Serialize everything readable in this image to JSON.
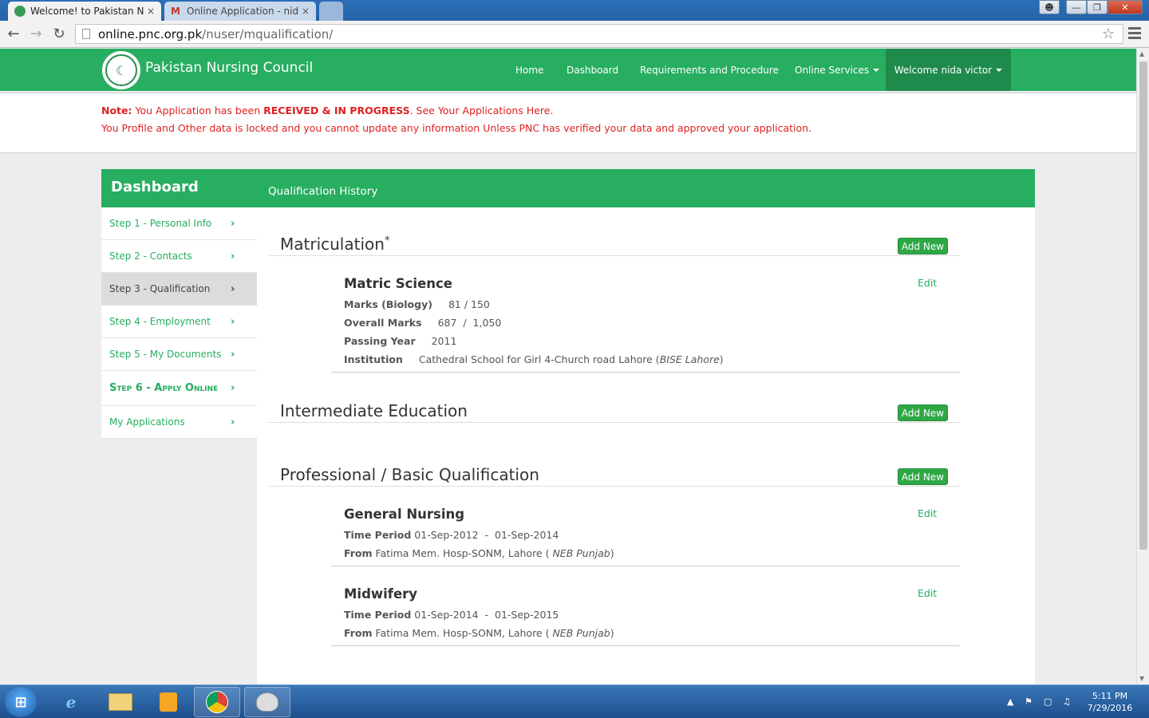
{
  "browser": {
    "tabs": [
      {
        "title": "Welcome! to Pakistan Nursing Council",
        "close": "×",
        "active": true
      },
      {
        "title": "Online Application - nida",
        "close": "×",
        "active": false
      }
    ],
    "url_host": "online.pnc.org.pk",
    "url_path": "/nuser/mqualification/",
    "icons": {
      "back": "arrow-left-icon",
      "forward": "arrow-right-icon",
      "reload": "reload-icon",
      "bookmark": "star-icon",
      "menu": "hamburger-icon"
    }
  },
  "site": {
    "brand": "Pakistan Nursing Council",
    "nav": {
      "home": "Home",
      "dashboard": "Dashboard",
      "requirements": "Requirements and Procedure",
      "online_services": "Online Services",
      "welcome": "Welcome nida victor"
    },
    "colors": {
      "primary": "#27ae60",
      "nav_active": "#1e8b4c",
      "notice": "#e02020",
      "button": "#2ea845"
    }
  },
  "notice": {
    "note_label": "Note:",
    "line1_a": " You Application has been ",
    "line1_status": "RECEIVED & IN PROGRESS",
    "line1_b": ". See Your Applications ",
    "line1_link": "Here",
    "line1_end": ".",
    "line2": "You Profile and Other data is locked and you cannot update any information Unless PNC has verified your data and approved your application."
  },
  "sidebar": {
    "title": "Dashboard",
    "chevron": "›",
    "items": [
      {
        "label": "Step 1 - Personal Info"
      },
      {
        "label": "Step 2 - Contacts"
      },
      {
        "label": "Step 3 - Qualification"
      },
      {
        "label": "Step 4 - Employment"
      },
      {
        "label": "Step 5 - My Documents"
      },
      {
        "label": "Step 6 - Apply Online"
      },
      {
        "label": "My Applications"
      }
    ]
  },
  "panel": {
    "title": "Qualification History",
    "add_label": "Add New",
    "edit_label": "Edit",
    "matric": {
      "title": "Matriculation",
      "required_mark": "*",
      "entry": {
        "title": "Matric Science",
        "marks_bio_label": "Marks (Biology)",
        "marks_bio_value": "81 / 150",
        "overall_label": "Overall Marks",
        "overall_value": "687  /  1,050",
        "year_label": "Passing Year",
        "year_value": "2011",
        "inst_label": "Institution",
        "inst_value": "Cathedral School for Girl 4-Church road Lahore (",
        "inst_board": "BISE Lahore",
        "inst_end": ")"
      }
    },
    "intermediate": {
      "title": "Intermediate Education"
    },
    "professional": {
      "title": "Professional / Basic Qualification",
      "entries": [
        {
          "title": "General Nursing",
          "period_label": "Time Period",
          "period_value": "01-Sep-2012  -  01-Sep-2014",
          "from_label": "From",
          "from_value": "Fatima Mem. Hosp-SONM, Lahore ( ",
          "board": "NEB Punjab",
          "board_end": ")"
        },
        {
          "title": "Midwifery",
          "period_label": "Time Period",
          "period_value": "01-Sep-2014  -  01-Sep-2015",
          "from_label": "From",
          "from_value": "Fatima Mem. Hosp-SONM, Lahore ( ",
          "board": "NEB Punjab",
          "board_end": ")"
        }
      ]
    }
  },
  "taskbar": {
    "time": "5:11 PM",
    "date": "7/29/2016"
  }
}
